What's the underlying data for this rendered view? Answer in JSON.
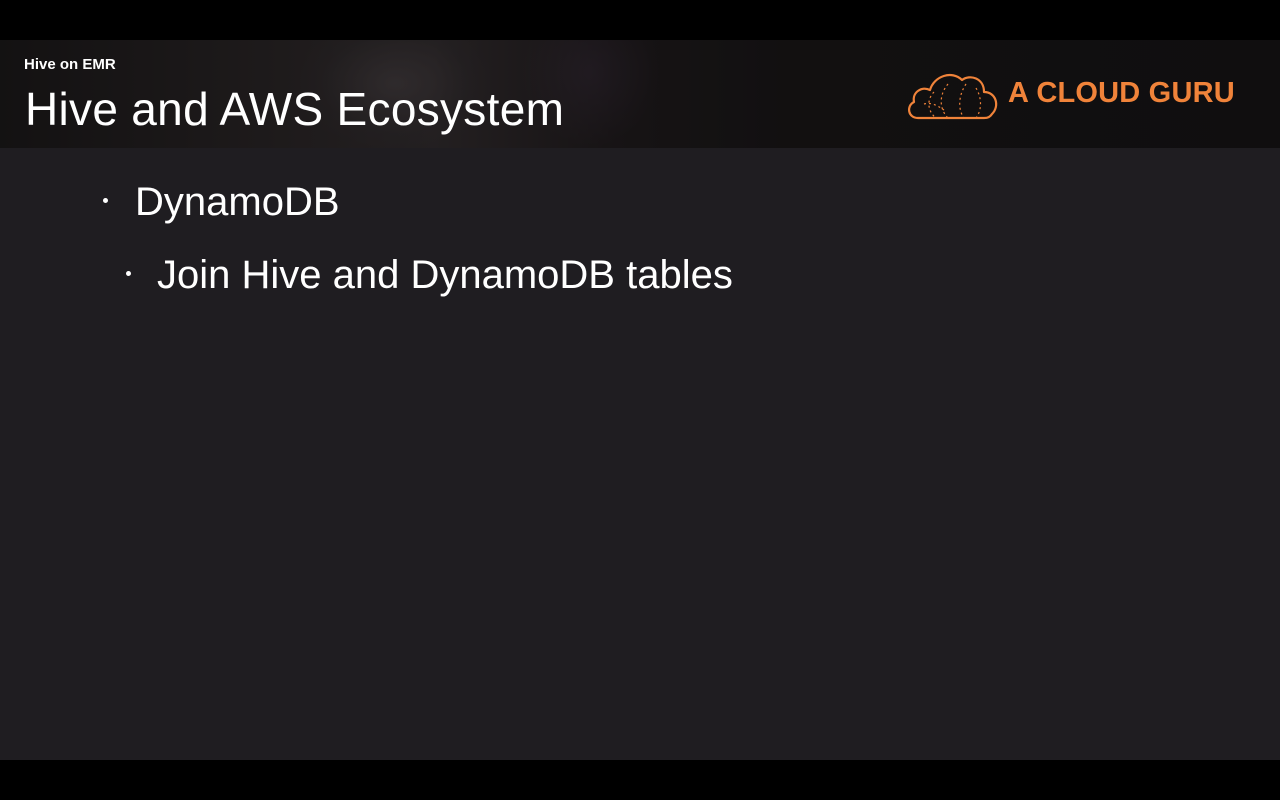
{
  "header": {
    "subtitle": "Hive on EMR",
    "title": "Hive and AWS Ecosystem"
  },
  "logo": {
    "text": "A CLOUD GURU",
    "icon": "cloud-icon",
    "color": "#f0833a"
  },
  "bullets": [
    {
      "level": 1,
      "text": "DynamoDB"
    },
    {
      "level": 2,
      "text": "Join Hive and DynamoDB tables"
    }
  ],
  "colors": {
    "background": "#1f1d21",
    "text": "#ffffff",
    "accent": "#f0833a"
  }
}
